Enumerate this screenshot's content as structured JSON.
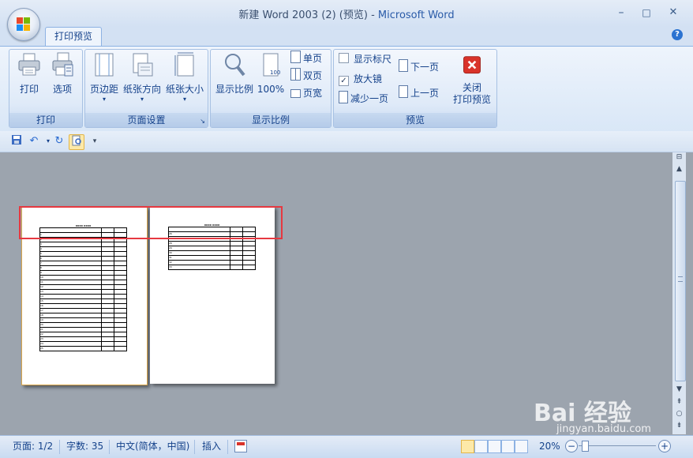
{
  "window": {
    "title_main": "新建 Word 2003 (2) (预览)",
    "title_sep": " - ",
    "title_app": "Microsoft Word",
    "minimize": "–",
    "maximize": "□",
    "close": "✕"
  },
  "tabs": [
    {
      "label": "打印预览"
    }
  ],
  "help": "?",
  "ribbon": {
    "groups": [
      {
        "label": "打印",
        "buttons": [
          {
            "label": "打印",
            "icon": "printer-icon"
          },
          {
            "label": "选项",
            "icon": "print-options-icon"
          }
        ]
      },
      {
        "label": "页面设置",
        "buttons": [
          {
            "label": "页边距",
            "icon": "margins-icon"
          },
          {
            "label": "纸张方向",
            "icon": "orientation-icon"
          },
          {
            "label": "纸张大小",
            "icon": "paper-size-icon"
          }
        ]
      },
      {
        "label": "显示比例",
        "buttons": [
          {
            "label": "显示比例",
            "icon": "zoom-icon"
          },
          {
            "label": "100%",
            "icon": "zoom-100-icon"
          }
        ],
        "small": [
          {
            "label": "单页"
          },
          {
            "label": "双页"
          },
          {
            "label": "页宽"
          }
        ]
      },
      {
        "label": "预览",
        "checks": [
          {
            "label": "显示标尺",
            "checked": false
          },
          {
            "label": "放大镜",
            "checked": true
          }
        ],
        "small": [
          {
            "label": "减少一页"
          },
          {
            "label": "下一页"
          },
          {
            "label": "上一页"
          }
        ],
        "close": "关闭\n打印预览"
      }
    ],
    "close_line1": "关闭",
    "close_line2": "打印预览"
  },
  "qat_more": "▾",
  "document": {
    "table_title": "XXXX XXXX",
    "page1_rows": [
      "",
      "1",
      "2",
      "3",
      "4",
      "5",
      "6",
      "7",
      "8",
      "9",
      "10",
      "11",
      "12",
      "13",
      "14",
      "15",
      "16",
      "17",
      "18",
      "19",
      "20",
      "21",
      "22",
      "23",
      "24",
      "25"
    ],
    "page2_rows": [
      "",
      "26",
      "27",
      "28",
      "29",
      "30",
      "31",
      "32",
      "33"
    ]
  },
  "statusbar": {
    "page": "页面: 1/2",
    "words": "字数: 35",
    "language": "中文(简体，中国)",
    "mode": "插入",
    "zoom": "20%",
    "zoom_minus": "−",
    "zoom_plus": "+"
  },
  "scroll": {
    "up": "▲",
    "down": "▼",
    "prev": "⇞",
    "select": "○",
    "next": "⇟"
  },
  "watermark": {
    "main": "Bai 经验",
    "sub": "jingyan.baidu.com"
  },
  "colors": {
    "highlight": "#e63840",
    "ribbon_text": "#15428b",
    "close_red": "#d9332a"
  }
}
